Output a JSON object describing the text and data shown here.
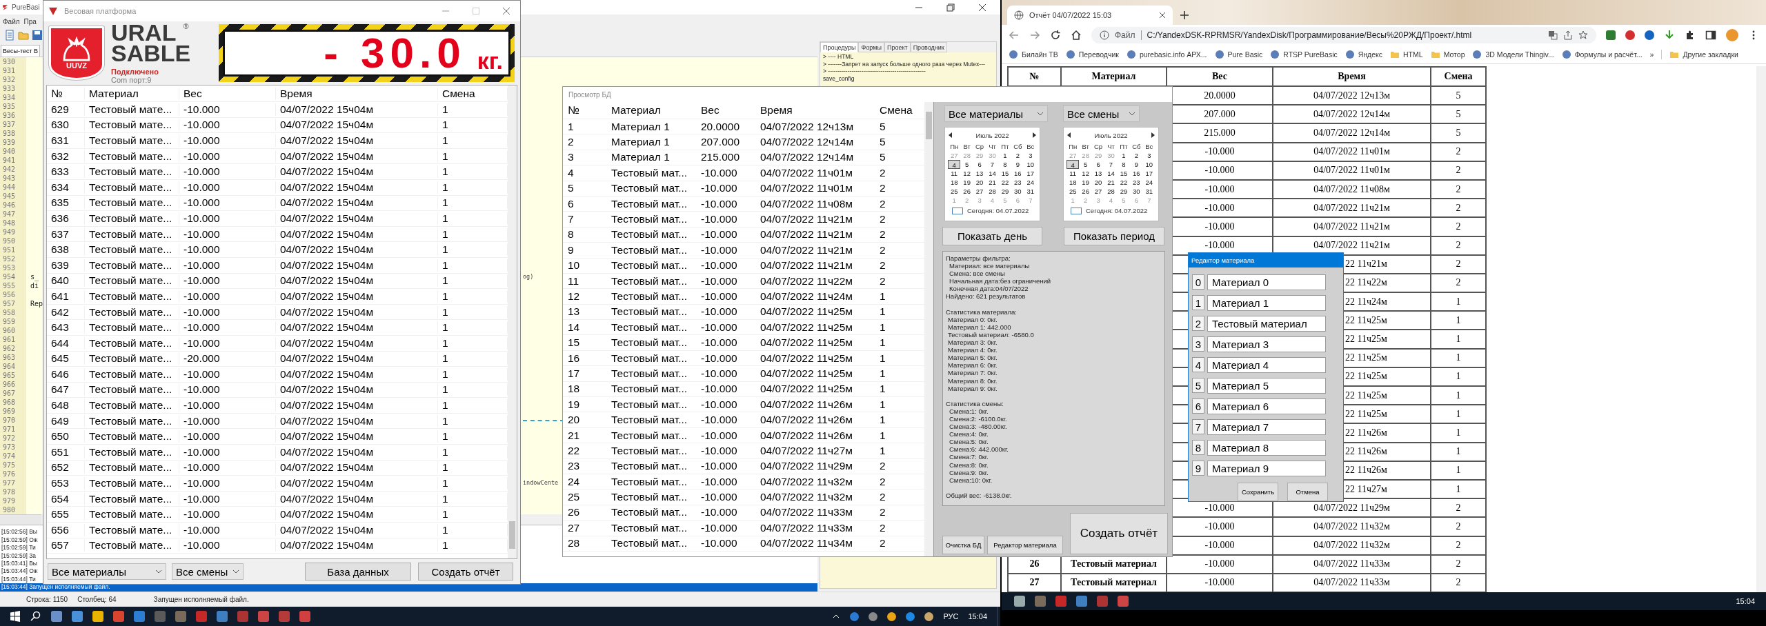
{
  "ide": {
    "title": "PureBasi",
    "menu": [
      "Файл",
      "Пра"
    ],
    "tab": "Весы-тест В",
    "lines": [
      {
        "n": "930",
        "kind": "code"
      },
      {
        "n": "931",
        "kind": "code"
      },
      {
        "n": "932",
        "kind": "code"
      },
      {
        "n": "933",
        "kind": "code"
      },
      {
        "n": "934",
        "kind": "code"
      },
      {
        "n": "935",
        "kind": "code"
      },
      {
        "n": "936",
        "kind": "code"
      },
      {
        "n": "937",
        "kind": "code"
      },
      {
        "n": "938",
        "kind": "code"
      },
      {
        "n": "939",
        "kind": "code"
      },
      {
        "n": "940",
        "kind": "code"
      },
      {
        "n": "941",
        "kind": "code"
      },
      {
        "n": "942",
        "kind": "code"
      },
      {
        "n": "943",
        "kind": "code"
      },
      {
        "n": "944",
        "kind": "code"
      },
      {
        "n": "945",
        "kind": "code"
      },
      {
        "n": "946",
        "kind": "code"
      },
      {
        "n": "947",
        "kind": "code"
      },
      {
        "n": "948",
        "kind": "code"
      },
      {
        "n": "949",
        "kind": "code"
      },
      {
        "n": "950",
        "kind": "code"
      },
      {
        "n": "951",
        "kind": "code"
      },
      {
        "n": "952",
        "kind": "code"
      },
      {
        "n": "953",
        "kind": "code"
      },
      {
        "n": "954",
        "kind": "code",
        "left": "s_",
        "right": "og)"
      },
      {
        "n": "955",
        "kind": "code",
        "left": "di"
      },
      {
        "n": "956",
        "kind": "code"
      },
      {
        "n": "957",
        "kind": "code",
        "left": "Rep"
      },
      {
        "n": "958",
        "kind": "code"
      },
      {
        "n": "959",
        "kind": "code"
      },
      {
        "n": "960",
        "kind": "code"
      },
      {
        "n": "961",
        "kind": "code"
      },
      {
        "n": "962",
        "kind": "code"
      },
      {
        "n": "963",
        "kind": "code"
      },
      {
        "n": "964",
        "kind": "code"
      },
      {
        "n": "965",
        "kind": "code"
      },
      {
        "n": "966",
        "kind": "code"
      },
      {
        "n": "967",
        "kind": "code"
      },
      {
        "n": "968",
        "kind": "code"
      },
      {
        "n": "969",
        "kind": "code"
      },
      {
        "n": "970",
        "kind": "separator"
      },
      {
        "n": "971",
        "kind": "code"
      },
      {
        "n": "972",
        "kind": "code"
      },
      {
        "n": "973",
        "kind": "code"
      },
      {
        "n": "974",
        "kind": "code"
      },
      {
        "n": "975",
        "kind": "code"
      },
      {
        "n": "976",
        "kind": "code"
      },
      {
        "n": "977",
        "kind": "code",
        "right": "indowCente"
      },
      {
        "n": "978",
        "kind": "code"
      },
      {
        "n": "979",
        "kind": "code"
      },
      {
        "n": "980",
        "kind": "code"
      }
    ],
    "panel_tabs": [
      {
        "label": "Процедуры",
        "selected": true
      },
      {
        "label": "Формы",
        "selected": false
      },
      {
        "label": "Проект",
        "selected": false
      },
      {
        "label": "Проводник",
        "selected": false
      }
    ],
    "procedures": [
      "> ---- HTML",
      "> -------Запрет на запуск больше одного раза через Mutex---",
      "> --------------------------------------------------",
      "save_config"
    ],
    "log": [
      {
        "text": "[15:02:56] Вы",
        "selected": false
      },
      {
        "text": "[15:02:59] Ож",
        "selected": false
      },
      {
        "text": "[15:02:59] Ти",
        "selected": false
      },
      {
        "text": "[15:02:59] За",
        "selected": false
      },
      {
        "text": "[15:03:41] Вы",
        "selected": false
      },
      {
        "text": "[15:03:44] Ож",
        "selected": false
      },
      {
        "text": "[15:03:44] Ти",
        "selected": false
      },
      {
        "text": "[15:03:44] Запущен исполняемый файл.",
        "selected": true
      }
    ],
    "status": {
      "row": "Строка: 1150",
      "column": "Столбец: 64",
      "message": "Запущен исполняемый файл."
    }
  },
  "scale_window": {
    "title": "Весовая платформа",
    "logo_text": "UUVZ",
    "brand": [
      "URAL",
      "SABLE"
    ],
    "brand_mark": "®",
    "connection": "Подключено",
    "port": "Com порт:9",
    "display": {
      "value": "- 30.0",
      "unit": "кг."
    },
    "columns": [
      "№",
      "Материал",
      "Вес",
      "Время",
      "Смена"
    ],
    "rows": [
      [
        "629",
        "Тестовый мате...",
        "-10.000",
        "04/07/2022 15ч04м",
        "1"
      ],
      [
        "630",
        "Тестовый мате...",
        "-10.000",
        "04/07/2022 15ч04м",
        "1"
      ],
      [
        "631",
        "Тестовый мате...",
        "-10.000",
        "04/07/2022 15ч04м",
        "1"
      ],
      [
        "632",
        "Тестовый мате...",
        "-10.000",
        "04/07/2022 15ч04м",
        "1"
      ],
      [
        "633",
        "Тестовый мате...",
        "-10.000",
        "04/07/2022 15ч04м",
        "1"
      ],
      [
        "634",
        "Тестовый мате...",
        "-10.000",
        "04/07/2022 15ч04м",
        "1"
      ],
      [
        "635",
        "Тестовый мате...",
        "-10.000",
        "04/07/2022 15ч04м",
        "1"
      ],
      [
        "636",
        "Тестовый мате...",
        "-10.000",
        "04/07/2022 15ч04м",
        "1"
      ],
      [
        "637",
        "Тестовый мате...",
        "-10.000",
        "04/07/2022 15ч04м",
        "1"
      ],
      [
        "638",
        "Тестовый мате...",
        "-10.000",
        "04/07/2022 15ч04м",
        "1"
      ],
      [
        "639",
        "Тестовый мате...",
        "-10.000",
        "04/07/2022 15ч04м",
        "1"
      ],
      [
        "640",
        "Тестовый мате...",
        "-10.000",
        "04/07/2022 15ч04м",
        "1"
      ],
      [
        "641",
        "Тестовый мате...",
        "-10.000",
        "04/07/2022 15ч04м",
        "1"
      ],
      [
        "642",
        "Тестовый мате...",
        "-10.000",
        "04/07/2022 15ч04м",
        "1"
      ],
      [
        "643",
        "Тестовый мате...",
        "-10.000",
        "04/07/2022 15ч04м",
        "1"
      ],
      [
        "644",
        "Тестовый мате...",
        "-10.000",
        "04/07/2022 15ч04м",
        "1"
      ],
      [
        "645",
        "Тестовый мате...",
        "-20.000",
        "04/07/2022 15ч04м",
        "1"
      ],
      [
        "646",
        "Тестовый мате...",
        "-10.000",
        "04/07/2022 15ч04м",
        "1"
      ],
      [
        "647",
        "Тестовый мате...",
        "-10.000",
        "04/07/2022 15ч04м",
        "1"
      ],
      [
        "648",
        "Тестовый мате...",
        "-10.000",
        "04/07/2022 15ч04м",
        "1"
      ],
      [
        "649",
        "Тестовый мате...",
        "-10.000",
        "04/07/2022 15ч04м",
        "1"
      ],
      [
        "650",
        "Тестовый мате...",
        "-10.000",
        "04/07/2022 15ч04м",
        "1"
      ],
      [
        "651",
        "Тестовый мате...",
        "-10.000",
        "04/07/2022 15ч04м",
        "1"
      ],
      [
        "652",
        "Тестовый мате...",
        "-10.000",
        "04/07/2022 15ч04м",
        "1"
      ],
      [
        "653",
        "Тестовый мате...",
        "-10.000",
        "04/07/2022 15ч04м",
        "1"
      ],
      [
        "654",
        "Тестовый мате...",
        "-10.000",
        "04/07/2022 15ч04м",
        "1"
      ],
      [
        "655",
        "Тестовый мате...",
        "-10.000",
        "04/07/2022 15ч04м",
        "1"
      ],
      [
        "656",
        "Тестовый мате...",
        "-10.000",
        "04/07/2022 15ч04м",
        "1"
      ],
      [
        "657",
        "Тестовый мате...",
        "-10.000",
        "04/07/2022 15ч04м",
        "1"
      ]
    ],
    "material_filter": "Все материалы",
    "shift_filter": "Все смены",
    "buttons": [
      "База данных",
      "Создать отчёт"
    ]
  },
  "db_window": {
    "title": "Просмотр БД",
    "columns": [
      "№",
      "Материал",
      "Вес",
      "Время",
      "Смена"
    ],
    "rows": [
      [
        "1",
        "Материал 1",
        "20.0000",
        "04/07/2022 12ч13м",
        "5"
      ],
      [
        "2",
        "Материал 1",
        "207.000",
        "04/07/2022 12ч14м",
        "5"
      ],
      [
        "3",
        "Материал 1",
        "215.000",
        "04/07/2022 12ч14м",
        "5"
      ],
      [
        "4",
        "Тестовый мат...",
        "-10.000",
        "04/07/2022 11ч01м",
        "2"
      ],
      [
        "5",
        "Тестовый мат...",
        "-10.000",
        "04/07/2022 11ч01м",
        "2"
      ],
      [
        "6",
        "Тестовый мат...",
        "-10.000",
        "04/07/2022 11ч08м",
        "2"
      ],
      [
        "7",
        "Тестовый мат...",
        "-10.000",
        "04/07/2022 11ч21м",
        "2"
      ],
      [
        "8",
        "Тестовый мат...",
        "-10.000",
        "04/07/2022 11ч21м",
        "2"
      ],
      [
        "9",
        "Тестовый мат...",
        "-10.000",
        "04/07/2022 11ч21м",
        "2"
      ],
      [
        "10",
        "Тестовый мат...",
        "-10.000",
        "04/07/2022 11ч21м",
        "2"
      ],
      [
        "11",
        "Тестовый мат...",
        "-10.000",
        "04/07/2022 11ч22м",
        "2"
      ],
      [
        "12",
        "Тестовый мат...",
        "-10.000",
        "04/07/2022 11ч24м",
        "1"
      ],
      [
        "13",
        "Тестовый мат...",
        "-10.000",
        "04/07/2022 11ч25м",
        "1"
      ],
      [
        "14",
        "Тестовый мат...",
        "-10.000",
        "04/07/2022 11ч25м",
        "1"
      ],
      [
        "15",
        "Тестовый мат...",
        "-10.000",
        "04/07/2022 11ч25м",
        "1"
      ],
      [
        "16",
        "Тестовый мат...",
        "-10.000",
        "04/07/2022 11ч25м",
        "1"
      ],
      [
        "17",
        "Тестовый мат...",
        "-10.000",
        "04/07/2022 11ч25м",
        "1"
      ],
      [
        "18",
        "Тестовый мат...",
        "-10.000",
        "04/07/2022 11ч25м",
        "1"
      ],
      [
        "19",
        "Тестовый мат...",
        "-10.000",
        "04/07/2022 11ч26м",
        "1"
      ],
      [
        "20",
        "Тестовый мат...",
        "-10.000",
        "04/07/2022 11ч26м",
        "1"
      ],
      [
        "21",
        "Тестовый мат...",
        "-10.000",
        "04/07/2022 11ч26м",
        "1"
      ],
      [
        "22",
        "Тестовый мат...",
        "-10.000",
        "04/07/2022 11ч27м",
        "1"
      ],
      [
        "23",
        "Тестовый мат...",
        "-10.000",
        "04/07/2022 11ч29м",
        "2"
      ],
      [
        "24",
        "Тестовый мат...",
        "-10.000",
        "04/07/2022 11ч32м",
        "2"
      ],
      [
        "25",
        "Тестовый мат...",
        "-10.000",
        "04/07/2022 11ч32м",
        "2"
      ],
      [
        "26",
        "Тестовый мат...",
        "-10.000",
        "04/07/2022 11ч33м",
        "2"
      ],
      [
        "27",
        "Тестовый мат...",
        "-10.000",
        "04/07/2022 11ч33м",
        "2"
      ],
      [
        "28",
        "Тестовый мат...",
        "-10.000",
        "04/07/2022 11ч34м",
        "2"
      ]
    ],
    "material_filter": "Все материалы",
    "shift_filter": "Все смены",
    "calendars": [
      {
        "month": "Июль 2022",
        "weekdays": [
          "Пн",
          "Вт",
          "Ср",
          "Чт",
          "Пт",
          "Сб",
          "Вс"
        ],
        "before": [
          "27",
          "28",
          "29",
          "30"
        ],
        "days": [
          {
            "d": "1",
            "selected": false
          },
          {
            "d": "2",
            "selected": false
          },
          {
            "d": "3",
            "selected": false
          },
          {
            "d": "4",
            "selected": true
          },
          {
            "d": "5",
            "selected": false
          },
          {
            "d": "6",
            "selected": false
          },
          {
            "d": "7",
            "selected": false
          },
          {
            "d": "8",
            "selected": false
          },
          {
            "d": "9",
            "selected": false
          },
          {
            "d": "10",
            "selected": false
          },
          {
            "d": "11",
            "selected": false
          },
          {
            "d": "12",
            "selected": false
          },
          {
            "d": "13",
            "selected": false
          },
          {
            "d": "14",
            "selected": false
          },
          {
            "d": "15",
            "selected": false
          },
          {
            "d": "16",
            "selected": false
          },
          {
            "d": "17",
            "selected": false
          },
          {
            "d": "18",
            "selected": false
          },
          {
            "d": "19",
            "selected": false
          },
          {
            "d": "20",
            "selected": false
          },
          {
            "d": "21",
            "selected": false
          },
          {
            "d": "22",
            "selected": false
          },
          {
            "d": "23",
            "selected": false
          },
          {
            "d": "24",
            "selected": false
          },
          {
            "d": "25",
            "selected": false
          },
          {
            "d": "26",
            "selected": false
          },
          {
            "d": "27",
            "selected": false
          },
          {
            "d": "28",
            "selected": false
          },
          {
            "d": "29",
            "selected": false
          },
          {
            "d": "30",
            "selected": false
          },
          {
            "d": "31",
            "selected": false
          }
        ],
        "after": [
          "1",
          "2",
          "3",
          "4",
          "5",
          "6",
          "7"
        ],
        "today": "Сегодня: 04.07.2022"
      },
      {
        "month": "Июль 2022",
        "weekdays": [
          "Пн",
          "Вт",
          "Ср",
          "Чт",
          "Пт",
          "Сб",
          "Вс"
        ],
        "before": [
          "27",
          "28",
          "29",
          "30"
        ],
        "days": [
          {
            "d": "1",
            "selected": false
          },
          {
            "d": "2",
            "selected": false
          },
          {
            "d": "3",
            "selected": false
          },
          {
            "d": "4",
            "selected": true
          },
          {
            "d": "5",
            "selected": false
          },
          {
            "d": "6",
            "selected": false
          },
          {
            "d": "7",
            "selected": false
          },
          {
            "d": "8",
            "selected": false
          },
          {
            "d": "9",
            "selected": false
          },
          {
            "d": "10",
            "selected": false
          },
          {
            "d": "11",
            "selected": false
          },
          {
            "d": "12",
            "selected": false
          },
          {
            "d": "13",
            "selected": false
          },
          {
            "d": "14",
            "selected": false
          },
          {
            "d": "15",
            "selected": false
          },
          {
            "d": "16",
            "selected": false
          },
          {
            "d": "17",
            "selected": false
          },
          {
            "d": "18",
            "selected": false
          },
          {
            "d": "19",
            "selected": false
          },
          {
            "d": "20",
            "selected": false
          },
          {
            "d": "21",
            "selected": false
          },
          {
            "d": "22",
            "selected": false
          },
          {
            "d": "23",
            "selected": false
          },
          {
            "d": "24",
            "selected": false
          },
          {
            "d": "25",
            "selected": false
          },
          {
            "d": "26",
            "selected": false
          },
          {
            "d": "27",
            "selected": false
          },
          {
            "d": "28",
            "selected": false
          },
          {
            "d": "29",
            "selected": false
          },
          {
            "d": "30",
            "selected": false
          },
          {
            "d": "31",
            "selected": false
          }
        ],
        "after": [
          "1",
          "2",
          "3",
          "4",
          "5",
          "6",
          "7"
        ],
        "today": "Сегодня: 04.07.2022"
      }
    ],
    "show_day": "Показать день",
    "show_period": "Показать период",
    "report": {
      "filter_heading": "Параметры фильтра:",
      "filter_items": [
        "Материал: все материалы",
        "Смена: все смены",
        "Начальная дата:без ограничений",
        "Конечная дата:04/07/2022"
      ],
      "found": "Найдено: 621 результатов",
      "material_heading": "Статистика материала:",
      "material_items": [
        "Материал 0: 0кг.",
        "Материал 1: 442.000",
        "Тестовый материал: -6580.0",
        "Материал 3: 0кг.",
        "Материал 4: 0кг.",
        "Материал 5: 0кг.",
        "Материал 6: 0кг.",
        "Материал 7: 0кг.",
        "Материал 8: 0кг.",
        "Материал 9: 0кг."
      ],
      "shift_heading": "Статистика смены:",
      "shift_items": [
        "Смена:1: 0кг.",
        "Смена:2: -6100.0кг.",
        "Смена:3: -480.00кг.",
        "Смена:4: 0кг.",
        "Смена:5: 0кг.",
        "Смена:6: 442.000кг.",
        "Смена:7: 0кг.",
        "Смена:8: 0кг.",
        "Смена:9: 0кг.",
        "Смена:10: 0кг."
      ],
      "total": "Общий вес: -6138.0кг."
    },
    "small_buttons": [
      "Очистка БД",
      "Редактор материала"
    ],
    "create_report": "Создать отчёт"
  },
  "browser": {
    "tab": "Отчёт 04/07/2022 15:03",
    "scheme": "Файл",
    "url": "C:/YandexDSK-RPRMSR/YandexDisk/Программирование/Весы%20РЖД/Проект/.html",
    "bookmarks": [
      {
        "label": "Билайн ТВ",
        "kind": "site"
      },
      {
        "label": "Переводчик",
        "kind": "site"
      },
      {
        "label": "purebasic.info АРХ...",
        "kind": "site"
      },
      {
        "label": "Pure Basic",
        "kind": "site"
      },
      {
        "label": "RTSP PureBasic",
        "kind": "site"
      },
      {
        "label": "Яндекс",
        "kind": "site"
      },
      {
        "label": "HTML",
        "kind": "folder"
      },
      {
        "label": "Мотор",
        "kind": "folder"
      },
      {
        "label": "3D Модели Thingiv...",
        "kind": "site"
      },
      {
        "label": "Формулы и расчёт...",
        "kind": "site"
      }
    ],
    "more": "»",
    "other_bookmarks": "Другие закладки",
    "columns": [
      "№",
      "Материал",
      "Вес",
      "Время",
      "Смена"
    ],
    "rows": [
      {
        "weight": "20.0000",
        "time": "04/07/2022 12ч13м",
        "shift": "5"
      },
      {
        "weight": "207.000",
        "time": "04/07/2022 12ч14м",
        "shift": "5"
      },
      {
        "weight": "215.000",
        "time": "04/07/2022 12ч14м",
        "shift": "5"
      },
      {
        "weight": "-10.000",
        "time": "04/07/2022 11ч01м",
        "shift": "2"
      },
      {
        "weight": "-10.000",
        "time": "04/07/2022 11ч01м",
        "shift": "2"
      },
      {
        "weight": "-10.000",
        "time": "04/07/2022 11ч08м",
        "shift": "2"
      },
      {
        "weight": "-10.000",
        "time": "04/07/2022 11ч21м",
        "shift": "2"
      },
      {
        "weight": "-10.000",
        "time": "04/07/2022 11ч21м",
        "shift": "2"
      },
      {
        "weight": "-10.000",
        "time": "04/07/2022 11ч21м",
        "shift": "2"
      },
      {
        "time_fragment": "22 11ч21м",
        "shift": "2"
      },
      {
        "time_fragment": "22 11ч22м",
        "shift": "2"
      },
      {
        "time_fragment": "22 11ч24м",
        "shift": "1"
      },
      {
        "time_fragment": "22 11ч25м",
        "shift": "1"
      },
      {
        "time_fragment": "22 11ч25м",
        "shift": "1"
      },
      {
        "time_fragment": "22 11ч25м",
        "shift": "1"
      },
      {
        "time_fragment": "22 11ч25м",
        "shift": "1"
      },
      {
        "time_fragment": "22 11ч25м",
        "shift": "1"
      },
      {
        "time_fragment": "22 11ч25м",
        "shift": "1"
      },
      {
        "time_fragment": "22 11ч26м",
        "shift": "1"
      },
      {
        "time_fragment": "22 11ч26м",
        "shift": "1"
      },
      {
        "time_fragment": "22 11ч26м",
        "shift": "1"
      },
      {
        "time_fragment": "22 11ч27м",
        "shift": "1"
      },
      {
        "weight": "-10.000",
        "time": "04/07/2022 11ч29м",
        "shift": "2"
      },
      {
        "weight": "-10.000",
        "time": "04/07/2022 11ч32м",
        "shift": "2"
      },
      {
        "weight": "-10.000",
        "time": "04/07/2022 11ч32м",
        "shift": "2"
      },
      {
        "number": "26",
        "material": "Тестовый материал",
        "weight": "-10.000",
        "time": "04/07/2022 11ч33м",
        "shift": "2"
      },
      {
        "number": "27",
        "material": "Тестовый материал",
        "weight": "-10.000",
        "time": "04/07/2022 11ч33м",
        "shift": "2"
      }
    ]
  },
  "material_editor": {
    "title": "Редактор материала",
    "materials": [
      {
        "index": "0",
        "name": "Материал 0"
      },
      {
        "index": "1",
        "name": "Материал 1"
      },
      {
        "index": "2",
        "name": "Тестовый материал"
      },
      {
        "index": "3",
        "name": "Материал 3"
      },
      {
        "index": "4",
        "name": "Материал 4"
      },
      {
        "index": "5",
        "name": "Материал 5"
      },
      {
        "index": "6",
        "name": "Материал 6"
      },
      {
        "index": "7",
        "name": "Материал 7"
      },
      {
        "index": "8",
        "name": "Материал 8"
      },
      {
        "index": "9",
        "name": "Материал 9"
      }
    ],
    "buttons": [
      "Сохранить",
      "Отмена"
    ]
  },
  "taskbar_left": {
    "language": "РУС",
    "clock": "15:04"
  },
  "taskbar_right": {
    "clock": "15:04"
  }
}
